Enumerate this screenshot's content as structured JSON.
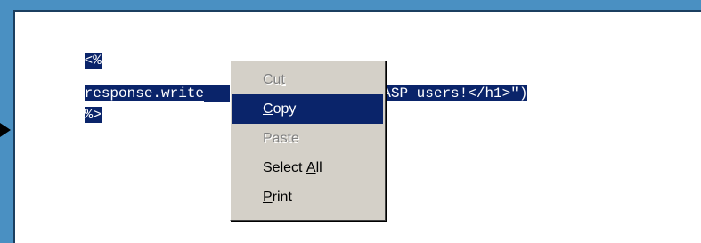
{
  "code": {
    "line1": "<%",
    "line2_left": "response.write",
    "line2_right": ", ASP users!</h1>\")",
    "line3": "%>"
  },
  "context_menu": {
    "items": [
      {
        "label_before": "Cu",
        "label_underline": "t",
        "label_after": "",
        "enabled": false,
        "highlighted": false
      },
      {
        "label_before": "",
        "label_underline": "C",
        "label_after": "opy",
        "enabled": true,
        "highlighted": true
      },
      {
        "label_before": "Paste",
        "label_underline": "",
        "label_after": "",
        "enabled": false,
        "highlighted": false
      },
      {
        "label_before": "Select ",
        "label_underline": "A",
        "label_after": "ll",
        "enabled": true,
        "highlighted": false
      },
      {
        "label_before": "",
        "label_underline": "P",
        "label_after": "rint",
        "enabled": true,
        "highlighted": false
      }
    ]
  },
  "colors": {
    "background": "#4a90c2",
    "selection": "#0a246a",
    "menu_bg": "#d4d0c8"
  },
  "icons": {
    "pointer": "arrow-right-icon"
  }
}
